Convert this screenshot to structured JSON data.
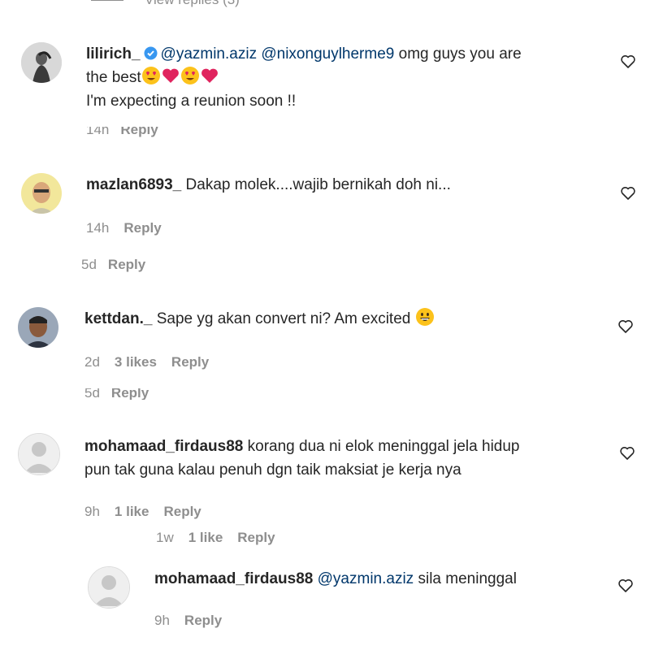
{
  "top": {
    "view_replies": "View replies (3)"
  },
  "comments": [
    {
      "username": "lilirich_",
      "mention1": "@yazmin.aziz",
      "mention2": "@nixonguylherme9",
      "text_line1_end": "omg guys you are",
      "text_line2": "the best",
      "text_line3": "I'm expecting a reunion soon !!",
      "time": "14h",
      "reply": "Reply"
    },
    {
      "username": "mazlan6893_",
      "text": "Dakap molek....wajib bernikah doh ni...",
      "time": "14h",
      "reply": "Reply"
    },
    {
      "username": "kettdan._",
      "text": "Sape yg akan convert ni? Am excited",
      "time": "2d",
      "likes": "3 likes",
      "reply": "Reply"
    },
    {
      "username": "mohamaad_firdaus88",
      "text_line1": "korang dua ni elok meninggal jela hidup",
      "text_line2": "pun tak guna kalau penuh dgn taik maksiat je kerja nya",
      "time": "9h",
      "likes": "1 like",
      "reply": "Reply"
    }
  ],
  "fragments": {
    "after_lilirich": {
      "time": "14h",
      "reply": "Reply"
    },
    "after_mazlan": {
      "time": "5d",
      "reply": "Reply"
    },
    "after_kettdan": {
      "time": "5d",
      "reply": "Reply"
    },
    "after_firdaus": {
      "time": "1w",
      "likes": "1 like",
      "reply": "Reply"
    }
  },
  "nested_reply": {
    "username": "mohamaad_firdaus88",
    "mention": "@yazmin.aziz",
    "text": "sila meninggal",
    "time": "9h",
    "reply": "Reply"
  },
  "colors": {
    "mention": "#00376b",
    "meta": "#8e8e8e",
    "verified": "#3897f0",
    "heart_red": "#e0245e"
  }
}
